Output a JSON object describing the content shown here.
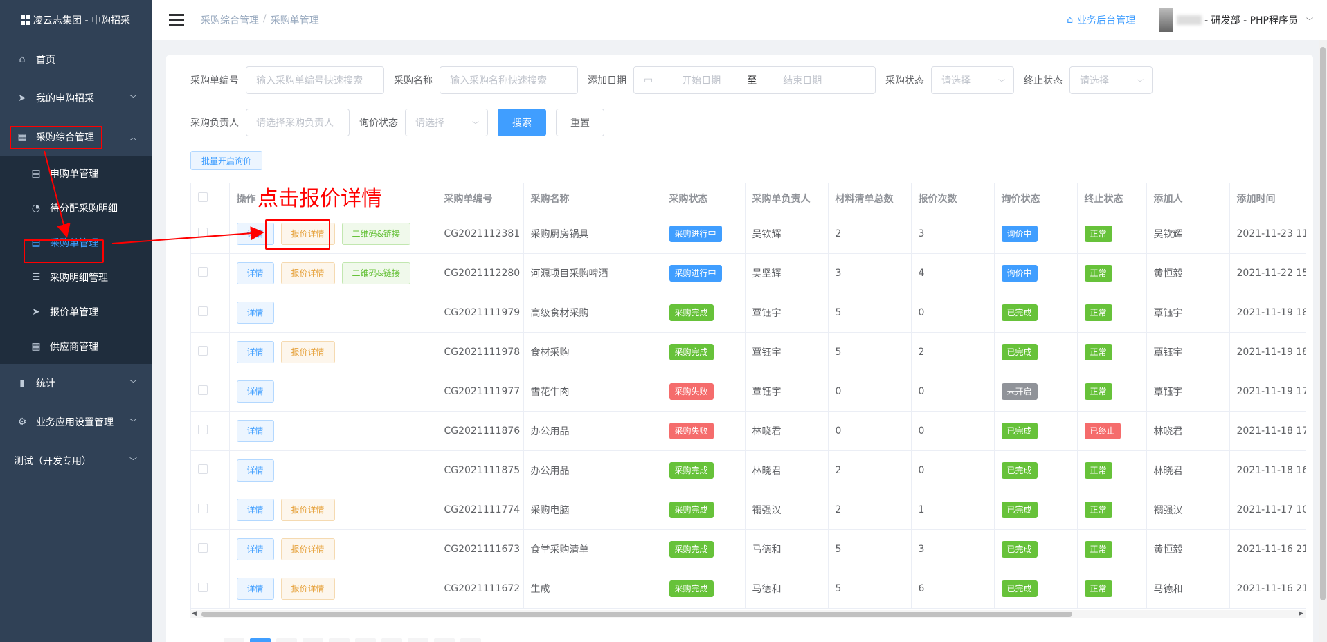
{
  "sidebar": {
    "logo": "凌云志集团 - 申购招采",
    "items": [
      {
        "label": "首页"
      },
      {
        "label": "我的申购招采"
      },
      {
        "label": "采购综合管理"
      }
    ],
    "sub_items": [
      {
        "label": "申购单管理"
      },
      {
        "label": "待分配采购明细"
      },
      {
        "label": "采购单管理"
      },
      {
        "label": "采购明细管理"
      },
      {
        "label": "报价单管理"
      },
      {
        "label": "供应商管理"
      }
    ],
    "bottom_items": [
      {
        "label": "统计"
      },
      {
        "label": "业务应用设置管理"
      },
      {
        "label": "测试（开发专用）"
      }
    ]
  },
  "header": {
    "breadcrumb_1": "采购综合管理",
    "breadcrumb_sep": "/",
    "breadcrumb_2": "采购单管理",
    "home_link": "业务后台管理",
    "user": "- 研发部 - PHP程序员"
  },
  "filters": {
    "order_no_label": "采购单编号",
    "order_no_placeholder": "输入采购单编号快速搜索",
    "name_label": "采购名称",
    "name_placeholder": "输入采购名称快速搜索",
    "date_label": "添加日期",
    "date_start": "开始日期",
    "date_sep": "至",
    "date_end": "结束日期",
    "status_label": "采购状态",
    "status_placeholder": "请选择",
    "stop_label": "终止状态",
    "stop_placeholder": "请选择",
    "owner_label": "采购负责人",
    "owner_placeholder": "请选择采购负责人",
    "inquiry_label": "询价状态",
    "inquiry_placeholder": "请选择",
    "search_btn": "搜索",
    "reset_btn": "重置"
  },
  "batch_button": "批量开启询价",
  "annotation": "点击报价详情",
  "table": {
    "headers": [
      "操作",
      "采购单编号",
      "采购名称",
      "采购状态",
      "采购单负责人",
      "材料清单总数",
      "报价次数",
      "询价状态",
      "终止状态",
      "添加人",
      "添加时间"
    ],
    "btn_detail": "详情",
    "btn_quote": "报价详情",
    "btn_qr": "二维码&链接",
    "rows": [
      {
        "no": "CG2021112381",
        "name": "采购厨房锅具",
        "status": "采购进行中",
        "status_color": "#409eff",
        "owner": "吴钦辉",
        "materials": "2",
        "quotes": "3",
        "inquiry": "询价中",
        "inquiry_color": "#409eff",
        "stop": "正常",
        "stop_color": "#67c23a",
        "creator": "吴钦辉",
        "time": "2021-11-23 11:",
        "quote_btn": true,
        "qr_btn": true
      },
      {
        "no": "CG2021112280",
        "name": "河源项目采购啤酒",
        "status": "采购进行中",
        "status_color": "#409eff",
        "owner": "吴坚辉",
        "materials": "3",
        "quotes": "4",
        "inquiry": "询价中",
        "inquiry_color": "#409eff",
        "stop": "正常",
        "stop_color": "#67c23a",
        "creator": "黄恒毅",
        "time": "2021-11-22 15:",
        "quote_btn": true,
        "qr_btn": true
      },
      {
        "no": "CG2021111979",
        "name": "高级食材采购",
        "status": "采购完成",
        "status_color": "#67c23a",
        "owner": "覃钰宇",
        "materials": "5",
        "quotes": "0",
        "inquiry": "已完成",
        "inquiry_color": "#67c23a",
        "stop": "正常",
        "stop_color": "#67c23a",
        "creator": "覃钰宇",
        "time": "2021-11-19 18:",
        "quote_btn": false,
        "qr_btn": false
      },
      {
        "no": "CG2021111978",
        "name": "食材采购",
        "status": "采购完成",
        "status_color": "#67c23a",
        "owner": "覃钰宇",
        "materials": "5",
        "quotes": "2",
        "inquiry": "已完成",
        "inquiry_color": "#67c23a",
        "stop": "正常",
        "stop_color": "#67c23a",
        "creator": "覃钰宇",
        "time": "2021-11-19 18:",
        "quote_btn": true,
        "qr_btn": false
      },
      {
        "no": "CG2021111977",
        "name": "雪花牛肉",
        "status": "采购失败",
        "status_color": "#f56c6c",
        "owner": "覃钰宇",
        "materials": "0",
        "quotes": "0",
        "inquiry": "未开启",
        "inquiry_color": "#909399",
        "stop": "正常",
        "stop_color": "#67c23a",
        "creator": "覃钰宇",
        "time": "2021-11-19 17:",
        "quote_btn": false,
        "qr_btn": false
      },
      {
        "no": "CG2021111876",
        "name": "办公用品",
        "status": "采购失败",
        "status_color": "#f56c6c",
        "owner": "林晓君",
        "materials": "0",
        "quotes": "0",
        "inquiry": "已完成",
        "inquiry_color": "#67c23a",
        "stop": "已终止",
        "stop_color": "#f56c6c",
        "creator": "林晓君",
        "time": "2021-11-18 17:",
        "quote_btn": false,
        "qr_btn": false
      },
      {
        "no": "CG2021111875",
        "name": "办公用品",
        "status": "采购完成",
        "status_color": "#67c23a",
        "owner": "林晓君",
        "materials": "2",
        "quotes": "0",
        "inquiry": "已完成",
        "inquiry_color": "#67c23a",
        "stop": "正常",
        "stop_color": "#67c23a",
        "creator": "林晓君",
        "time": "2021-11-18 16:",
        "quote_btn": false,
        "qr_btn": false
      },
      {
        "no": "CG2021111774",
        "name": "采购电脑",
        "status": "采购完成",
        "status_color": "#67c23a",
        "owner": "禤强汉",
        "materials": "2",
        "quotes": "1",
        "inquiry": "已完成",
        "inquiry_color": "#67c23a",
        "stop": "正常",
        "stop_color": "#67c23a",
        "creator": "禤强汉",
        "time": "2021-11-17 10:",
        "quote_btn": true,
        "qr_btn": false
      },
      {
        "no": "CG2021111673",
        "name": "食堂采购清单",
        "status": "采购完成",
        "status_color": "#67c23a",
        "owner": "马德和",
        "materials": "5",
        "quotes": "3",
        "inquiry": "已完成",
        "inquiry_color": "#67c23a",
        "stop": "正常",
        "stop_color": "#67c23a",
        "creator": "黄恒毅",
        "time": "2021-11-16 21:",
        "quote_btn": true,
        "qr_btn": false
      },
      {
        "no": "CG2021111672",
        "name": "生成",
        "status": "采购完成",
        "status_color": "#67c23a",
        "owner": "马德和",
        "materials": "5",
        "quotes": "6",
        "inquiry": "已完成",
        "inquiry_color": "#67c23a",
        "stop": "正常",
        "stop_color": "#67c23a",
        "creator": "马德和",
        "time": "2021-11-16 21:",
        "quote_btn": true,
        "qr_btn": false
      }
    ]
  },
  "colors": {
    "accent": "#409eff",
    "sidebar_bg": "#304156",
    "annotation": "#ff0000"
  }
}
